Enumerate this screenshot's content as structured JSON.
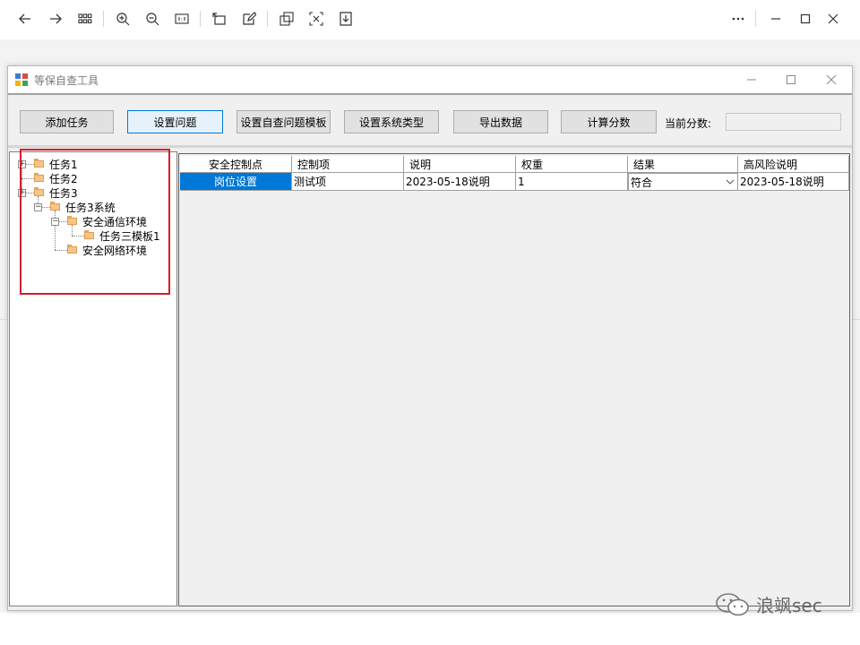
{
  "window": {
    "title": "等保自查工具"
  },
  "toolbar": {
    "buttons": [
      {
        "label": "添加任务"
      },
      {
        "label": "设置问题"
      },
      {
        "label": "设置自查问题模板"
      },
      {
        "label": "设置系统类型"
      },
      {
        "label": "导出数据"
      },
      {
        "label": "计算分数"
      }
    ],
    "active_button": "设置问题",
    "score_label": "当前分数:",
    "score_value": ""
  },
  "tree": {
    "nodes": [
      {
        "label": "任务1"
      },
      {
        "label": "任务2"
      },
      {
        "label": "任务3"
      },
      {
        "label": "任务3系统"
      },
      {
        "label": "安全通信环境"
      },
      {
        "label": "任务三模板1"
      },
      {
        "label": "安全网络环境"
      }
    ]
  },
  "grid": {
    "columns": [
      "安全控制点",
      "控制项",
      "说明",
      "权重",
      "结果",
      "高风险说明"
    ],
    "rows": [
      [
        "岗位设置",
        "测试项",
        "2023-05-18说明",
        "1",
        "符合",
        "2023-05-18说明"
      ]
    ]
  },
  "watermark": {
    "text": "浪飒sec"
  },
  "colors": {
    "selection": "#0078d7",
    "highlight_box": "#d0202c",
    "folder": "#f6c58a"
  }
}
